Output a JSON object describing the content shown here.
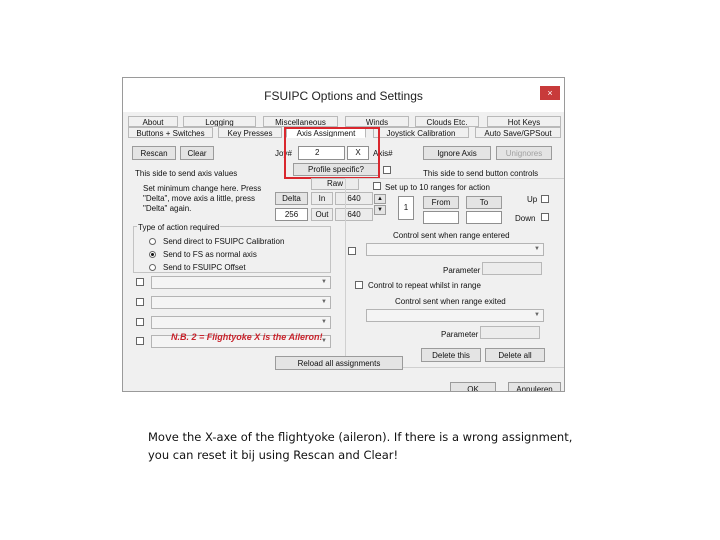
{
  "window": {
    "title": "FSUIPC Options and Settings",
    "close_icon": "×"
  },
  "tabs_row1": [
    "About",
    "Logging",
    "Miscellaneous",
    "Winds",
    "Clouds Etc.",
    "Hot Keys"
  ],
  "tabs_row2": [
    "Buttons + Switches",
    "Key Presses",
    "Axis Assignment",
    "Joystick Calibration",
    "Auto Save/GPSout"
  ],
  "toolbar": {
    "rescan": "Rescan",
    "clear": "Clear",
    "joy_label": "Joy#",
    "joy_value": "2",
    "axis_value": "X",
    "axis_label": "Axis#",
    "ignore_axis": "Ignore Axis",
    "unignore": "Unignores",
    "profile_specific": "Profile specific?"
  },
  "left": {
    "side_label": "This side to send axis values",
    "raw_label": "Raw",
    "instructions": [
      "Set minimum change here. Press",
      "\"Delta\", move axis a little, press",
      "\"Delta\" again."
    ],
    "delta_btn": "Delta",
    "delta_value": "256",
    "in_label": "In",
    "in_value": "640",
    "out_label": "Out",
    "out_value": "640",
    "action_group_label": "Type of action required",
    "radios": [
      "Send direct to FSUIPC Calibration",
      "Send to FS as normal axis",
      "Send to FSUIPC Offset"
    ],
    "selected_radio": 1,
    "note": "N.B. 2 = Flightyoke X is the Aileron!"
  },
  "right": {
    "side_label": "This side to send button controls",
    "ranges_label": "Set up to 10 ranges for action",
    "range_index": "1",
    "from_label": "From",
    "to_label": "To",
    "up_label": "Up",
    "down_label": "Down",
    "control_entered": "Control sent when range entered",
    "parameter1": "Parameter",
    "repeat_label": "Control to repeat whilst in range",
    "control_exited": "Control sent when range exited",
    "parameter2": "Parameter",
    "delete_this": "Delete this",
    "delete_all": "Delete all"
  },
  "reload": "Reload all assignments",
  "footer": {
    "ok": "OK",
    "cancel": "Annuleren"
  },
  "caption": {
    "line1": "Move the X-axe of the flightyoke (aileron). If there is a wrong assignment,",
    "line2": "you can reset it bij using Rescan and Clear!"
  },
  "colors": {
    "highlight": "#d9272e",
    "note_text": "#c8222b",
    "close_button": "#c83a3a"
  }
}
